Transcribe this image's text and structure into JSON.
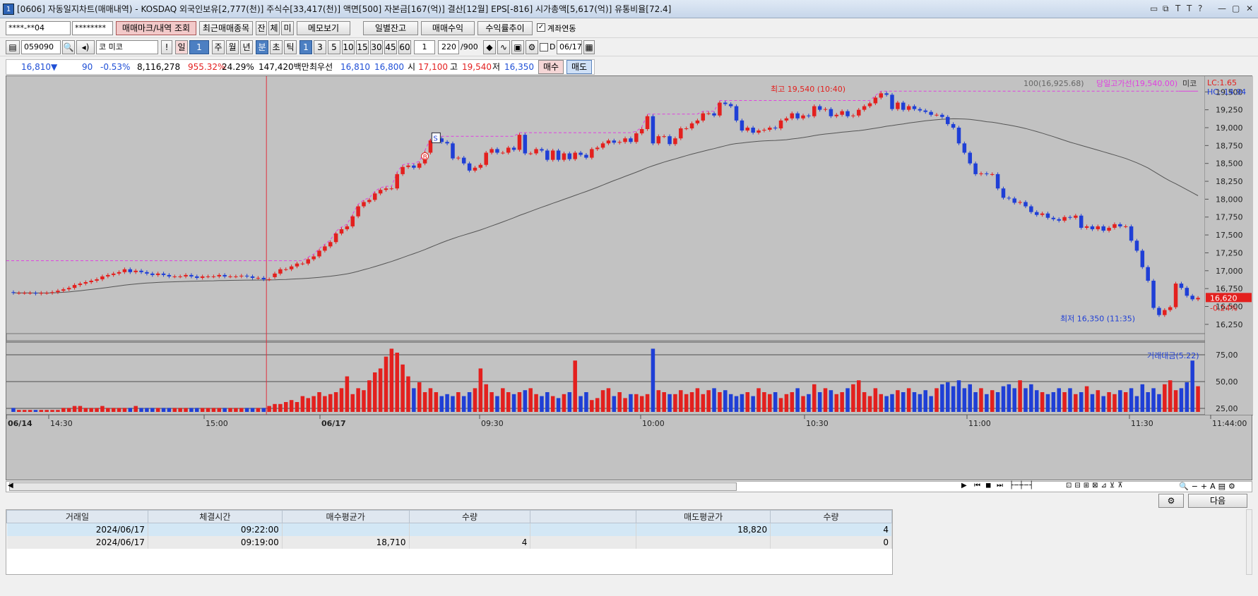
{
  "window": {
    "num": "1",
    "title": "[0606] 자동일지차트(매매내역) - KOSDAQ 외국인보유[2,777(천)] 주식수[33,417(천)] 액면[500] 자본금[167(억)] 결산[12월] EPS[-816] 시가총액[5,617(억)] 유통비율[72.4]",
    "controls": [
      "▭",
      "⧉",
      "T",
      "T",
      "?",
      "—",
      "▢",
      "✕"
    ]
  },
  "toolbar1": {
    "account": "****-**04",
    "password": "********",
    "btn_trade_mark": "매매마크/내역 조회",
    "btn_recent": "최근매매종목",
    "btn_jan": "잔",
    "btn_che": "체",
    "btn_mi": "미",
    "btn_memo": "메모보기",
    "btn_daily_balance": "일별잔고",
    "btn_profit": "매매수익",
    "btn_return": "수익률추이",
    "chk_link": "계좌연동"
  },
  "toolbar2": {
    "code": "059090",
    "name": "미코",
    "type_prefix": "코",
    "btn_excl": "!",
    "periods": [
      "일",
      "1",
      "주",
      "월",
      "년",
      "분",
      "초",
      "틱"
    ],
    "minutes": [
      "1",
      "3",
      "5",
      "10",
      "15",
      "30",
      "45",
      "60"
    ],
    "interval": "1",
    "count": "220",
    "count_total": "/900",
    "chk_d": "D",
    "date": "06/17"
  },
  "quote": {
    "price": "16,810",
    "arrow": "▼",
    "change": "90",
    "change_pct": "-0.53%",
    "volume": "8,116,278",
    "vol_ratio": "955.32%",
    "turnover": "24.29%",
    "amount": "147,420백만",
    "best_label": "최우선",
    "ask": "16,810",
    "bid": "16,800",
    "open_label": "시",
    "open": "17,100",
    "high_label": "고",
    "high": "19,540",
    "low_label": "저",
    "low": "16,350",
    "btn_buy": "매수",
    "btn_sell": "매도"
  },
  "chart_data": {
    "type": "candlestick",
    "title": "",
    "legend": {
      "ma": "100(16,925.68)",
      "prev_high": "당일고가선(19,540.00)",
      "name": "미코",
      "lc": "LC:1.65",
      "hc": "HC:-14.94",
      "vol_legend": "거래대금(5.22)"
    },
    "annotations": {
      "high": "최고 19,540 (10:40)",
      "low": "최저 16,350 (11:35)",
      "current": "16,620",
      "current_pct": "-0.24%",
      "buy_marker": "B",
      "sell_marker": "S"
    },
    "price_ticks": [
      "19,500",
      "19,250",
      "19,000",
      "18,750",
      "18,500",
      "18,250",
      "18,000",
      "17,750",
      "17,500",
      "17,250",
      "17,000",
      "16,750",
      "16,500",
      "16,250"
    ],
    "ylim": [
      16150,
      19700
    ],
    "vol_ticks": [
      "75,00",
      "50,00",
      "25,00"
    ],
    "x_labels": [
      "06/14",
      "14:30",
      "15:00",
      "06/17",
      "09:30",
      "10:00",
      "10:30",
      "11:00",
      "11:30",
      "11:44:00"
    ],
    "prev_close": 17140,
    "series": {
      "open": [
        16700,
        16690,
        16690,
        16690,
        16690,
        16680,
        16690,
        16690,
        16700,
        16720,
        16740,
        16760,
        16800,
        16820,
        16840,
        16860,
        16880,
        16920,
        16940,
        16960,
        16980,
        17020,
        16980,
        17000,
        16980,
        16960,
        16940,
        16960,
        16940,
        16920,
        16920,
        16920,
        16940,
        16920,
        16900,
        16920,
        16920,
        16920,
        16940,
        16920,
        16920,
        16920,
        16930,
        16920,
        16900,
        16900,
        16880,
        16910,
        16960,
        17020,
        17020,
        17060,
        17100,
        17100,
        17160,
        17200,
        17280,
        17340,
        17400,
        17520,
        17580,
        17620,
        17760,
        17900,
        17960,
        17990,
        18080,
        18130,
        18150,
        18150,
        18350,
        18450,
        18470,
        18440,
        18500,
        18650,
        18820,
        18850,
        18800,
        18780,
        18570,
        18580,
        18500,
        18400,
        18440,
        18480,
        18650,
        18700,
        18650,
        18650,
        18720,
        18690,
        18900,
        18640,
        18640,
        18700,
        18680,
        18550,
        18680,
        18550,
        18640,
        18560,
        18650,
        18620,
        18580,
        18700,
        18720,
        18780,
        18820,
        18790,
        18800,
        18850,
        18800,
        18920,
        18980,
        19160,
        18780,
        18880,
        18880,
        18770,
        18850,
        18990,
        18990,
        19060,
        19100,
        19200,
        19200,
        19170,
        19350,
        19330,
        19300,
        19100,
        18960,
        19000,
        18930,
        18960,
        18970,
        19000,
        18990,
        19100,
        19130,
        19200,
        19130,
        19170,
        19160,
        19300,
        19250,
        19260,
        19160,
        19180,
        19230,
        19160,
        19170,
        19250,
        19300,
        19340,
        19420,
        19480,
        19460,
        19260,
        19350,
        19250,
        19300,
        19260,
        19240,
        19220,
        19180,
        19180,
        19150,
        19050,
        19000,
        18780,
        18650,
        18500,
        18350,
        18360,
        18350,
        18350,
        18150,
        18020,
        18010,
        17950,
        17960,
        17900,
        17820,
        17780,
        17800,
        17740,
        17720,
        17700,
        17750,
        17740,
        17770,
        17600,
        17620,
        17580,
        17620,
        17560,
        17600,
        17650,
        17620,
        17620,
        17420,
        17280,
        17050,
        16860,
        16480,
        16380,
        16450,
        16490,
        16820,
        16760,
        16650,
        16600
      ],
      "close": [
        16690,
        16690,
        16690,
        16690,
        16680,
        16690,
        16690,
        16700,
        16720,
        16740,
        16760,
        16800,
        16820,
        16840,
        16860,
        16880,
        16920,
        16940,
        16960,
        16980,
        17020,
        16980,
        17000,
        16980,
        16960,
        16940,
        16960,
        16940,
        16920,
        16920,
        16920,
        16940,
        16920,
        16900,
        16920,
        16920,
        16920,
        16940,
        16920,
        16920,
        16920,
        16930,
        16920,
        16900,
        16900,
        16880,
        16880,
        16960,
        17020,
        17020,
        17060,
        17100,
        17100,
        17160,
        17200,
        17280,
        17340,
        17400,
        17520,
        17580,
        17620,
        17760,
        17900,
        17960,
        17990,
        18080,
        18130,
        18150,
        18150,
        18350,
        18450,
        18470,
        18440,
        18500,
        18650,
        18820,
        18850,
        18800,
        18780,
        18570,
        18580,
        18500,
        18400,
        18440,
        18480,
        18650,
        18700,
        18650,
        18650,
        18720,
        18690,
        18900,
        18640,
        18640,
        18700,
        18680,
        18550,
        18680,
        18550,
        18640,
        18560,
        18650,
        18620,
        18580,
        18700,
        18720,
        18780,
        18820,
        18790,
        18800,
        18850,
        18800,
        18920,
        18980,
        19160,
        18780,
        18880,
        18880,
        18770,
        18850,
        18990,
        18990,
        19060,
        19100,
        19200,
        19200,
        19170,
        19350,
        19330,
        19300,
        19100,
        18960,
        19000,
        18930,
        18960,
        18970,
        19000,
        18990,
        19100,
        19130,
        19200,
        19130,
        19170,
        19160,
        19300,
        19250,
        19260,
        19160,
        19180,
        19230,
        19160,
        19170,
        19250,
        19300,
        19340,
        19420,
        19480,
        19460,
        19260,
        19350,
        19250,
        19300,
        19260,
        19240,
        19220,
        19180,
        19180,
        19150,
        19050,
        19000,
        18780,
        18650,
        18500,
        18350,
        18360,
        18350,
        18350,
        18150,
        18020,
        18010,
        17950,
        17960,
        17900,
        17820,
        17780,
        17800,
        17740,
        17720,
        17700,
        17750,
        17740,
        17770,
        17600,
        17620,
        17580,
        17620,
        17560,
        17600,
        17650,
        17620,
        17620,
        17420,
        17280,
        17050,
        16860,
        16480,
        16380,
        16450,
        16490,
        16820,
        16760,
        16650,
        16600,
        16620
      ],
      "volume": [
        2,
        1,
        1,
        1,
        1,
        1,
        1,
        1,
        1,
        2,
        2,
        3,
        3,
        2,
        2,
        2,
        3,
        2,
        2,
        2,
        2,
        2,
        3,
        2,
        2,
        2,
        2,
        2,
        2,
        2,
        2,
        2,
        2,
        2,
        2,
        2,
        2,
        2,
        2,
        2,
        2,
        2,
        2,
        2,
        2,
        2,
        3,
        4,
        4,
        5,
        6,
        5,
        8,
        7,
        8,
        10,
        8,
        9,
        10,
        12,
        18,
        9,
        12,
        11,
        16,
        20,
        22,
        28,
        32,
        30,
        24,
        18,
        12,
        15,
        10,
        12,
        10,
        8,
        9,
        8,
        10,
        8,
        10,
        12,
        22,
        14,
        10,
        8,
        12,
        10,
        9,
        10,
        11,
        12,
        9,
        8,
        10,
        8,
        7,
        9,
        10,
        26,
        8,
        10,
        6,
        7,
        11,
        12,
        8,
        10,
        7,
        9,
        9,
        8,
        9,
        32,
        11,
        10,
        9,
        9,
        11,
        9,
        10,
        12,
        9,
        11,
        12,
        10,
        11,
        9,
        8,
        9,
        10,
        8,
        12,
        10,
        9,
        10,
        7,
        9,
        10,
        12,
        8,
        9,
        14,
        10,
        12,
        11,
        9,
        10,
        12,
        14,
        16,
        10,
        8,
        12,
        9,
        8,
        9,
        11,
        10,
        12,
        10,
        9,
        11,
        8,
        12,
        14,
        15,
        13,
        16,
        12,
        14,
        10,
        12,
        9,
        11,
        10,
        13,
        14,
        12,
        16,
        12,
        14,
        11,
        10,
        9,
        10,
        12,
        10,
        12,
        9,
        10,
        13,
        9,
        11,
        8,
        10,
        9,
        11,
        10,
        12,
        8,
        14,
        10,
        12,
        9,
        14,
        16,
        11,
        12,
        15,
        26,
        13,
        11,
        12,
        8,
        7
      ]
    }
  },
  "scroll_tools": [
    "◀",
    "▶",
    "▮◀",
    "◼",
    "▶▮"
  ],
  "grid": {
    "btn_next": "다음",
    "headers": [
      "거래일",
      "체결시간",
      "매수평균가",
      "수량",
      "",
      "매도평균가",
      "수량"
    ],
    "rows": [
      [
        "2024/06/17",
        "09:22:00",
        "",
        "",
        "",
        "18,820",
        "4"
      ],
      [
        "2024/06/17",
        "09:19:00",
        "18,710",
        "4",
        "",
        "",
        "0"
      ]
    ]
  }
}
